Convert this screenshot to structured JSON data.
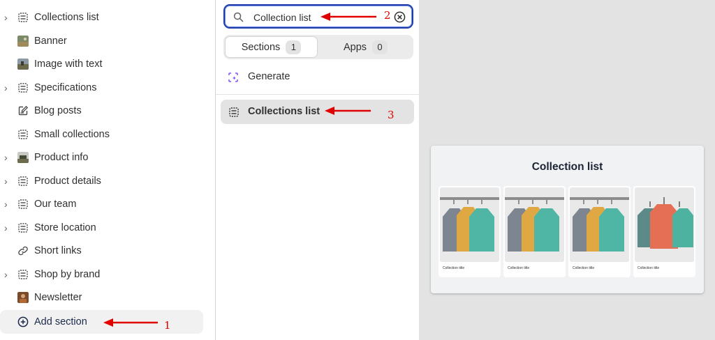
{
  "sidebar": {
    "items": [
      {
        "label": "Collections list",
        "icon": "section-icon",
        "expandable": true
      },
      {
        "label": "Banner",
        "icon": "image-thumb-icon",
        "expandable": false
      },
      {
        "label": "Image with text",
        "icon": "image-thumb-icon",
        "expandable": false
      },
      {
        "label": "Specifications",
        "icon": "section-icon",
        "expandable": true
      },
      {
        "label": "Blog posts",
        "icon": "edit-doc-icon",
        "expandable": false
      },
      {
        "label": "Small collections",
        "icon": "section-icon",
        "expandable": false
      },
      {
        "label": "Product info",
        "icon": "image-thumb-icon",
        "expandable": true
      },
      {
        "label": "Product details",
        "icon": "section-icon",
        "expandable": true
      },
      {
        "label": "Our team",
        "icon": "section-icon",
        "expandable": true
      },
      {
        "label": "Store location",
        "icon": "section-icon",
        "expandable": true
      },
      {
        "label": "Short links",
        "icon": "link-icon",
        "expandable": false
      },
      {
        "label": "Shop by brand",
        "icon": "section-icon",
        "expandable": true
      },
      {
        "label": "Newsletter",
        "icon": "image-thumb-icon",
        "expandable": false
      }
    ],
    "add_section_label": "Add section"
  },
  "panel": {
    "search": {
      "value": "Collection list",
      "placeholder": ""
    },
    "tabs": [
      {
        "label": "Sections",
        "count": "1",
        "selected": true
      },
      {
        "label": "Apps",
        "count": "0",
        "selected": false
      }
    ],
    "generate_label": "Generate",
    "result_label": "Collections list"
  },
  "preview": {
    "title": "Collection list",
    "items": [
      {
        "caption": "Collection title"
      },
      {
        "caption": "Collection title"
      },
      {
        "caption": "Collection title"
      },
      {
        "caption": "Collection title"
      }
    ]
  },
  "annotations": {
    "step1": "1",
    "step2": "2",
    "step3": "3"
  },
  "colors": {
    "annotation": "#e10000",
    "search_focus": "#1f3fa8",
    "selected_result_bg": "#e3e3e3",
    "preview_bg": "#e3e3e3",
    "generate_icon": "#8051ff"
  }
}
